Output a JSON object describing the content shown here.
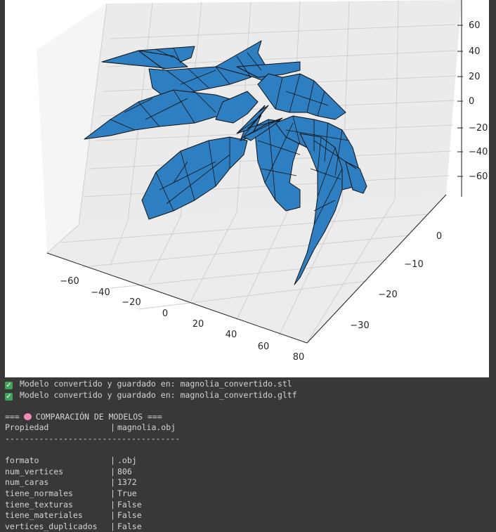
{
  "plot": {
    "axis_ticks": {
      "x": [
        "−60",
        "−40",
        "−20",
        "0",
        "20",
        "40",
        "60",
        "80"
      ],
      "y": [
        "0",
        "−10",
        "−20",
        "−30"
      ],
      "z": [
        "60",
        "40",
        "20",
        "0",
        "−20",
        "−40",
        "−60"
      ]
    },
    "mesh_color": "#2e7fc1",
    "edge_color": "#111111"
  },
  "console": {
    "messages": [
      {
        "icon": "check-mark-icon",
        "text": "Modelo convertido y guardado en: magnolia_convertido.stl"
      },
      {
        "icon": "check-mark-icon",
        "text": "Modelo convertido y guardado en: magnolia_convertido.gltf"
      }
    ],
    "comparison_prefix": "===",
    "comparison_title": "COMPARACIÓN DE MODELOS ===",
    "header": {
      "property": "Propiedad",
      "sep": "|",
      "model": "magnolia.obj"
    },
    "divider": "------------------------------------",
    "rows": [
      {
        "property": "formato",
        "sep": "|",
        "value": ".obj"
      },
      {
        "property": "num_vertices",
        "sep": "|",
        "value": "806"
      },
      {
        "property": "num_caras",
        "sep": "|",
        "value": "1372"
      },
      {
        "property": "tiene_normales",
        "sep": "|",
        "value": "True"
      },
      {
        "property": "tiene_texturas",
        "sep": "|",
        "value": "False"
      },
      {
        "property": "tiene_materiales",
        "sep": "|",
        "value": "False"
      },
      {
        "property": "vertices_duplicados",
        "sep": "|",
        "value": "False"
      }
    ]
  }
}
